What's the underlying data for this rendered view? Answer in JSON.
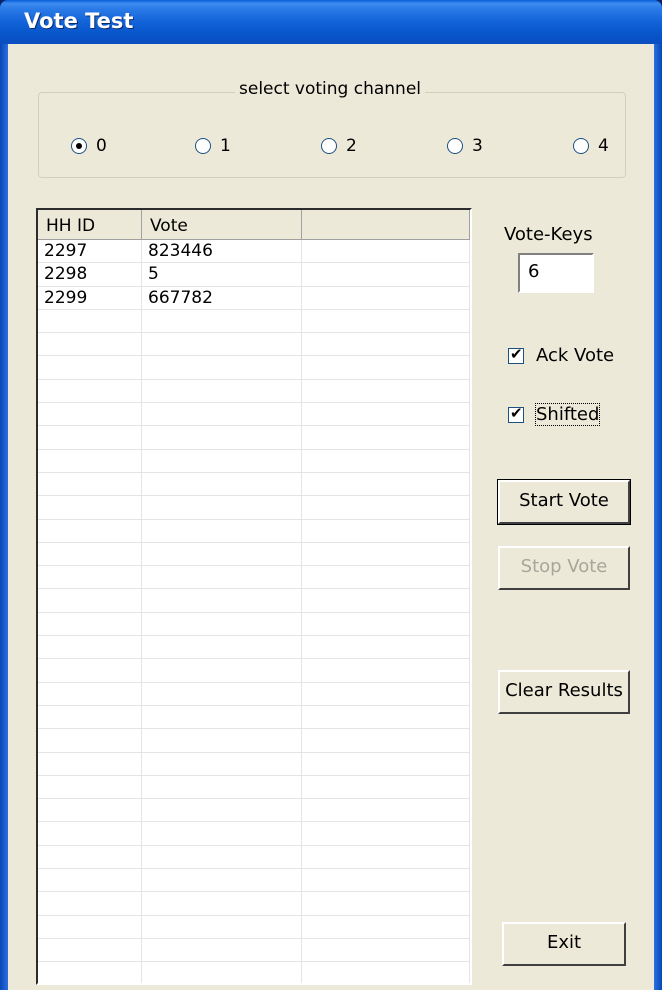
{
  "window": {
    "title": "Vote Test"
  },
  "channel_group": {
    "label": "select voting channel",
    "options": [
      "0",
      "1",
      "2",
      "3",
      "4"
    ],
    "selected": "0"
  },
  "table": {
    "columns": [
      "HH ID",
      "Vote",
      ""
    ],
    "rows": [
      [
        "2297",
        "823446",
        ""
      ],
      [
        "2298",
        "5",
        ""
      ],
      [
        "2299",
        "667782",
        ""
      ]
    ]
  },
  "vote_keys": {
    "label": "Vote-Keys",
    "value": "6"
  },
  "options": {
    "ack_vote": {
      "label": "Ack Vote",
      "checked": true
    },
    "shifted": {
      "label": "Shifted",
      "checked": true
    }
  },
  "buttons": {
    "start_vote": "Start Vote",
    "stop_vote": "Stop Vote",
    "clear_results": "Clear Results",
    "exit": "Exit"
  },
  "colors": {
    "titlebar": "#0a5fd8",
    "face": "#ece9d8",
    "disabled_text": "#a7a69b"
  }
}
